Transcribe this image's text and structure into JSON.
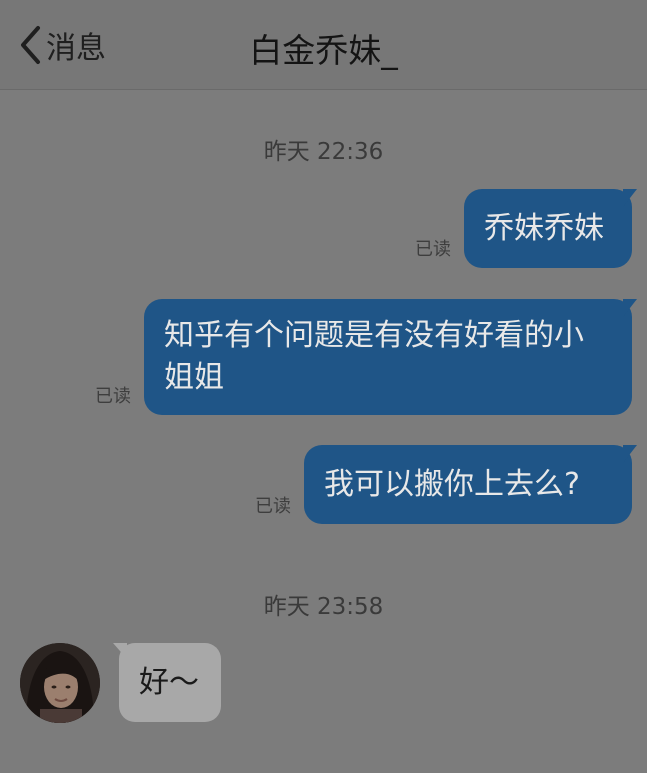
{
  "header": {
    "back_label": "消息",
    "title": "白金乔妹_"
  },
  "timestamps": [
    "昨天 22:36",
    "昨天 23:58"
  ],
  "messages": [
    {
      "text": "乔妹乔妹",
      "status": "已读"
    },
    {
      "text": "知乎有个问题是有没有好看的小姐姐",
      "line1": "知乎有个问题是有没有好看的小",
      "line2": "姐姐",
      "status": "已读"
    },
    {
      "text": "我可以搬你上去么?",
      "status": "已读"
    },
    {
      "text": "好～"
    }
  ],
  "colors": {
    "outgoing_bubble": "#1f5587",
    "incoming_bubble": "#a8a8a8",
    "background": "#7c7c7c"
  },
  "icons": [
    "chevron-left-icon"
  ]
}
